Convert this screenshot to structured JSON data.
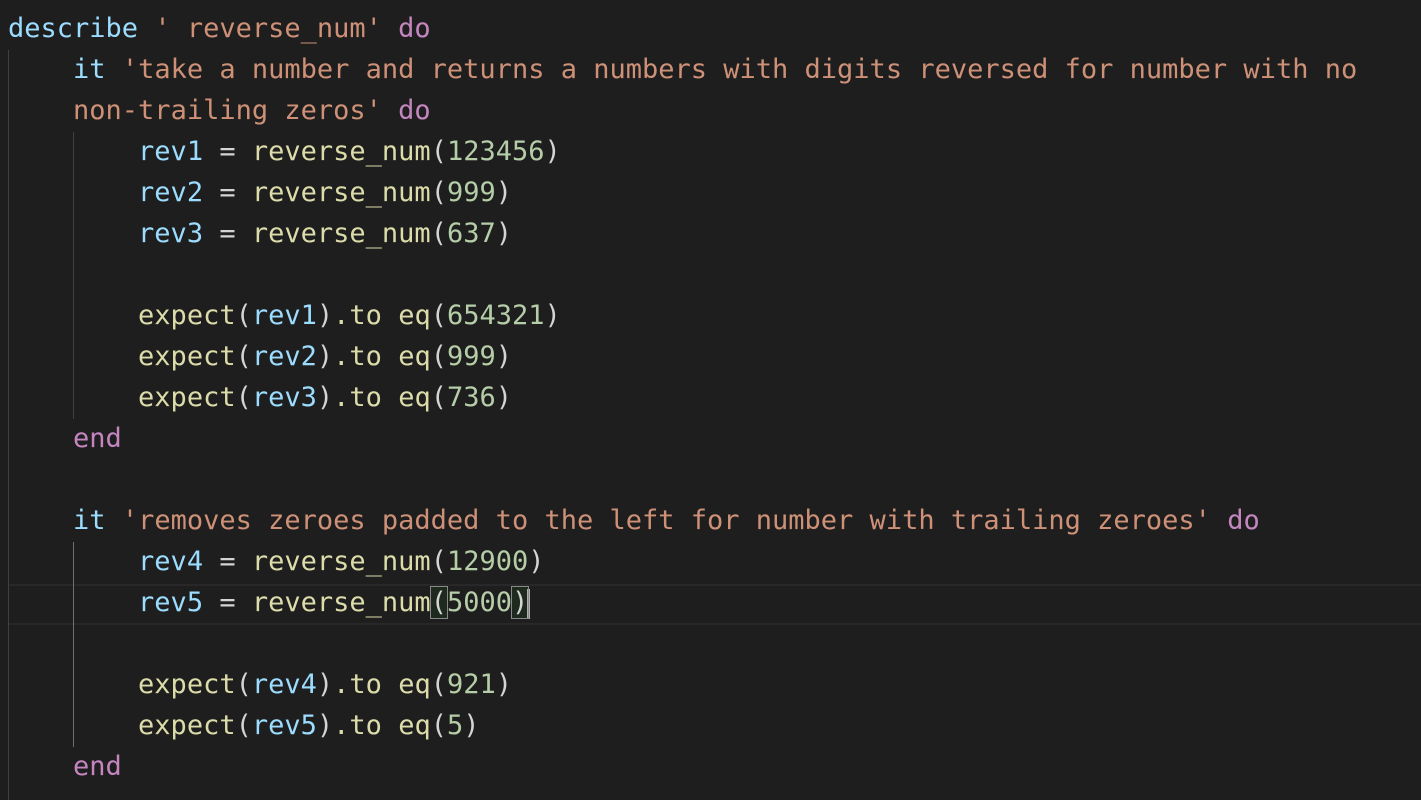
{
  "editor": {
    "language": "ruby",
    "lines": [
      {
        "describe_kw": "describe",
        "describe_str": "' reverse_num'",
        "do": "do"
      },
      {
        "it": "it",
        "str_a": "'take a number and returns a numbers with digits reversed for number with no"
      },
      {
        "str_b": "non-trailing zeros'",
        "do": "do"
      },
      {
        "var": "rev1",
        "op": "=",
        "fn": "reverse_num",
        "arg": "123456"
      },
      {
        "var": "rev2",
        "op": "=",
        "fn": "reverse_num",
        "arg": "999"
      },
      {
        "var": "rev3",
        "op": "=",
        "fn": "reverse_num",
        "arg": "637"
      },
      {},
      {
        "fn": "expect",
        "var": "rev1",
        "to": ".to",
        "eq": "eq",
        "arg": "654321"
      },
      {
        "fn": "expect",
        "var": "rev2",
        "to": ".to",
        "eq": "eq",
        "arg": "999"
      },
      {
        "fn": "expect",
        "var": "rev3",
        "to": ".to",
        "eq": "eq",
        "arg": "736"
      },
      {
        "end": "end"
      },
      {},
      {
        "it": "it",
        "str": "'removes zeroes padded to the left for number with trailing zeroes'",
        "do": "do"
      },
      {
        "var": "rev4",
        "op": "=",
        "fn": "reverse_num",
        "arg": "12900"
      },
      {
        "var": "rev5",
        "op": "=",
        "fn": "reverse_num",
        "arg": "5000"
      },
      {},
      {
        "fn": "expect",
        "var": "rev4",
        "to": ".to",
        "eq": "eq",
        "arg": "921"
      },
      {
        "fn": "expect",
        "var": "rev5",
        "to": ".to",
        "eq": "eq",
        "arg": "5"
      },
      {
        "end": "end"
      }
    ]
  },
  "colors": {
    "background": "#1e1e1e",
    "keyword": "#9cdcfe",
    "control": "#c586c0",
    "string": "#ce9178",
    "function": "#dcdcaa",
    "number": "#b5cea8"
  }
}
